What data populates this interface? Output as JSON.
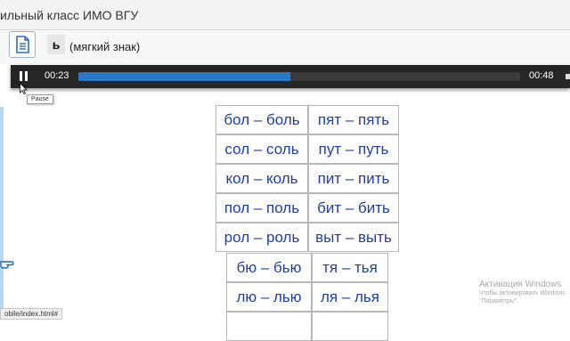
{
  "window": {
    "title": "ильный класс ИМО ВГУ"
  },
  "toolbar": {
    "letter": "ь",
    "item_title": "(мягкий знак)"
  },
  "player": {
    "current_time": "00:23",
    "duration": "00:48",
    "progress": 0.48,
    "pause_tooltip": "Pause"
  },
  "table1": {
    "rows": [
      [
        "бол – боль",
        "пят – пять"
      ],
      [
        "сол – соль",
        "пут – путь"
      ],
      [
        "кол – коль",
        "пит – пить"
      ],
      [
        "пол – поль",
        "бит – бить"
      ],
      [
        "рол – роль",
        "выт – выть"
      ]
    ]
  },
  "table2": {
    "rows": [
      [
        "бю – бью",
        "тя – тья"
      ],
      [
        "лю – лью",
        "ля – лья"
      ],
      [
        "",
        ""
      ]
    ]
  },
  "status": {
    "url": "obile/index.html#"
  },
  "activation": {
    "title": "Активация Windows",
    "line1": "Чтобы активировать Windows",
    "line2": "\"Параметры\"."
  },
  "colors": {
    "word_text": "#1f3fa8",
    "progress_fill": "#2a78c8",
    "player_bg": "#262626"
  }
}
